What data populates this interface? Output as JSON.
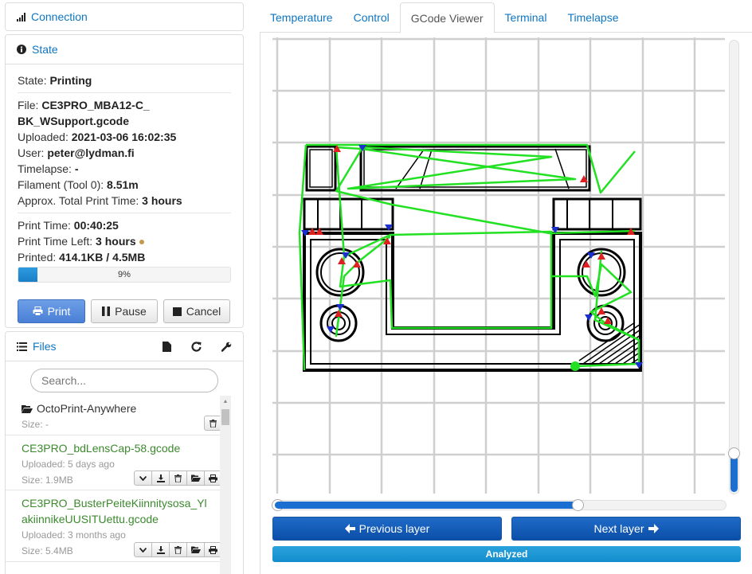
{
  "connection": {
    "title": "Connection"
  },
  "state": {
    "title": "State",
    "status_label": "State: ",
    "status_value": "Printing",
    "file_label": "File: ",
    "file_value": "CE3PRO_MBA12-C_BK_WSupport.gcode",
    "uploaded_label": "Uploaded: ",
    "uploaded_value": "2021-03-06 16:02:35",
    "user_label": "User: ",
    "user_value": "peter@lydman.fi",
    "timelapse_label": "Timelapse: ",
    "timelapse_value": "-",
    "filament_label": "Filament (Tool 0): ",
    "filament_value": "8.51m",
    "approx_label": "Approx. Total Print Time: ",
    "approx_value": "3 hours",
    "print_time_label": "Print Time: ",
    "print_time_value": "00:40:25",
    "time_left_label": "Print Time Left: ",
    "time_left_value": "3 hours",
    "printed_label": "Printed: ",
    "printed_value": "414.1KB / 4.5MB",
    "progress_text": "9%",
    "progress_fraction": 0.09,
    "print_button": "Print",
    "pause_button": "Pause",
    "cancel_button": "Cancel"
  },
  "files": {
    "title": "Files",
    "search_placeholder": "Search...",
    "items": [
      {
        "name": "OctoPrint-Anywhere",
        "folder": true,
        "meta1": "Size: -"
      },
      {
        "name": "CE3PRO_bdLensCap-58.gcode",
        "folder": false,
        "meta1": "Uploaded: 5 days ago",
        "meta2": "Size: 1.9MB"
      },
      {
        "name": "CE3PRO_BusterPeiteKiinnitysosa_YlakiinnikeUUSITUettu.gcode",
        "folder": false,
        "meta1": "Uploaded: 3 months ago",
        "meta2": "Size: 5.4MB"
      }
    ]
  },
  "tabs": [
    "Temperature",
    "Control",
    "GCode Viewer",
    "Terminal",
    "Timelapse"
  ],
  "active_tab": "GCode Viewer",
  "viewer": {
    "layer_fraction": 0.67,
    "zoom_fraction": 0.09,
    "prev_button": "Previous layer",
    "next_button": "Next layer",
    "status": "Analyzed"
  },
  "colors": {
    "accent": "#0e76c2",
    "travel": "#22e022",
    "extrusion": "#000000",
    "retract": "#e02020",
    "restore": "#1a2fd0"
  }
}
